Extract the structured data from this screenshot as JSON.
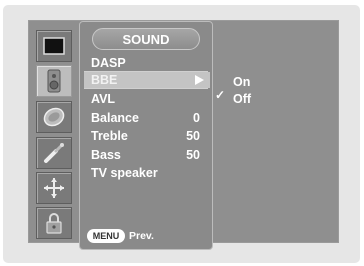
{
  "menu": {
    "title": "SOUND",
    "items": [
      {
        "label": "DASP",
        "value": ""
      },
      {
        "label": "BBE",
        "value": ""
      },
      {
        "label": "AVL",
        "value": ""
      },
      {
        "label": "Balance",
        "value": "0"
      },
      {
        "label": "Treble",
        "value": "50"
      },
      {
        "label": "Bass",
        "value": "50"
      },
      {
        "label": "TV speaker",
        "value": ""
      }
    ],
    "selected_index": 1
  },
  "submenu": {
    "options": [
      {
        "label": "On",
        "checked": true
      },
      {
        "label": "Off",
        "checked": false
      }
    ],
    "check_glyph": "✓"
  },
  "footer": {
    "button_label": "MENU",
    "action_label": "Prev."
  },
  "icons": [
    "picture-icon",
    "speaker-icon",
    "time-icon",
    "tools-icon",
    "screen-adjust-icon",
    "lock-icon"
  ]
}
